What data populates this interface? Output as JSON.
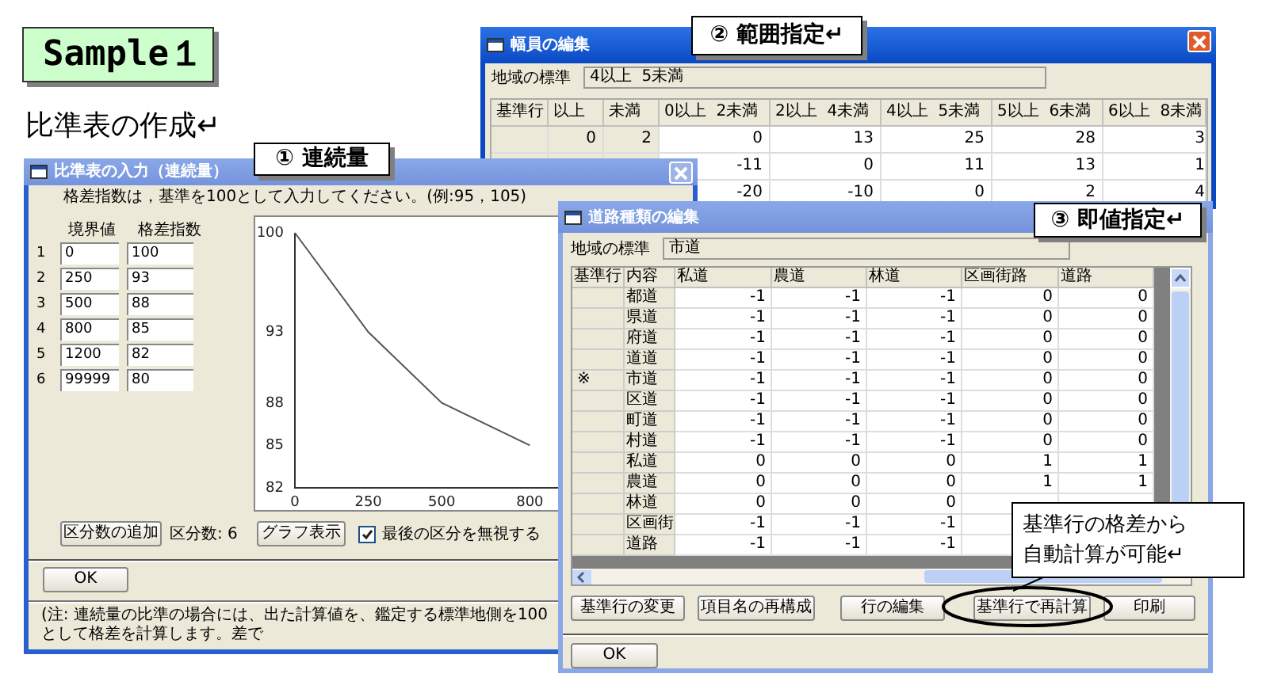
{
  "heading_box": {
    "text": "Sample１"
  },
  "heading": "比準表の作成↵",
  "callouts": [
    {
      "text": "① 連続量"
    },
    {
      "text": "② 範囲指定↵"
    },
    {
      "text": "③ 即値指定↵"
    }
  ],
  "width_window": {
    "title": "幅員の編集",
    "standard_label": "地域の標準",
    "standard_value": "4以上  5未満",
    "columns": [
      "基準行",
      "以上",
      "未満",
      "0以上  2未満",
      "2以上  4未満",
      "4以上  5未満",
      "5以上  6未満",
      "6以上  8未満"
    ],
    "rows": [
      {
        "lower": "0",
        "upper": "2",
        "values": [
          "0",
          "13",
          "25",
          "28",
          "3"
        ]
      },
      {
        "values": [
          "-11",
          "0",
          "11",
          "13",
          "1"
        ]
      },
      {
        "values": [
          "-20",
          "-10",
          "0",
          "2",
          "4"
        ]
      }
    ]
  },
  "continuous_window": {
    "title": "比準表の入力（連続量）",
    "instruction": "格差指数は，基準を100として入力してください。(例:95，105)",
    "columns": [
      "境界値",
      "格差指数"
    ],
    "rows": [
      {
        "number": "1",
        "boundary": "0",
        "index": "100"
      },
      {
        "number": "2",
        "boundary": "250",
        "index": "93"
      },
      {
        "number": "3",
        "boundary": "500",
        "index": "88"
      },
      {
        "number": "4",
        "boundary": "800",
        "index": "85"
      },
      {
        "number": "5",
        "boundary": "1200",
        "index": "82"
      },
      {
        "number": "6",
        "boundary": "99999",
        "index": "80"
      }
    ],
    "chart_data": {
      "type": "line",
      "x": [
        0,
        250,
        500,
        800
      ],
      "series": [
        {
          "color": "#555555",
          "values": [
            100,
            93,
            88,
            85
          ]
        }
      ],
      "xlim": [
        0,
        950
      ],
      "ylim": [
        82,
        100
      ],
      "xticks": [
        0,
        250,
        500,
        800
      ],
      "yticks": [
        82,
        85,
        88,
        93,
        100
      ]
    },
    "add_button": "区分数の追加",
    "count": "区分数: 6",
    "graph_button": "グラフ表示",
    "ignore_last": {
      "label": "最後の区分を無視する",
      "checked": true
    },
    "ok": "OK",
    "note": "(注:  連続量の比準の場合には、出た計算値を、鑑定する標準地側を100として格差を計算します。差で"
  },
  "road_window": {
    "title": "道路種類の編集",
    "standard_label": "地域の標準",
    "standard_value": "市道",
    "columns": [
      "基準行",
      "内容",
      "私道",
      "農道",
      "林道",
      "区画街路",
      "道路"
    ],
    "rows": [
      {
        "name": "都道",
        "values": [
          "-1",
          "-1",
          "-1",
          "0",
          "0"
        ]
      },
      {
        "name": "県道",
        "values": [
          "-1",
          "-1",
          "-1",
          "0",
          "0"
        ]
      },
      {
        "name": "府道",
        "values": [
          "-1",
          "-1",
          "-1",
          "0",
          "0"
        ]
      },
      {
        "name": "道道",
        "values": [
          "-1",
          "-1",
          "-1",
          "0",
          "0"
        ]
      },
      {
        "mark": "※",
        "name": "市道",
        "values": [
          "-1",
          "-1",
          "-1",
          "0",
          "0"
        ]
      },
      {
        "name": "区道",
        "values": [
          "-1",
          "-1",
          "-1",
          "0",
          "0"
        ]
      },
      {
        "name": "町道",
        "values": [
          "-1",
          "-1",
          "-1",
          "0",
          "0"
        ]
      },
      {
        "name": "村道",
        "values": [
          "-1",
          "-1",
          "-1",
          "0",
          "0"
        ]
      },
      {
        "name": "私道",
        "values": [
          "0",
          "0",
          "0",
          "1",
          "1"
        ]
      },
      {
        "name": "農道",
        "values": [
          "0",
          "0",
          "0",
          "1",
          "1"
        ]
      },
      {
        "name": "林道",
        "values": [
          "0",
          "0",
          "0"
        ]
      },
      {
        "name": "区画街",
        "values": [
          "-1",
          "-1",
          "-1"
        ]
      },
      {
        "name": "道路",
        "values": [
          "-1",
          "-1",
          "-1"
        ]
      }
    ],
    "buttons": [
      {
        "label": "基準行の変更",
        "circled": false
      },
      {
        "label": "項目名の再構成",
        "circled": false
      },
      {
        "label": "行の編集",
        "circled": false
      },
      {
        "label": "基準行で再計算",
        "circled": true
      },
      {
        "label": "印刷",
        "circled": false
      }
    ],
    "ok": "OK"
  },
  "annotation": {
    "lines": [
      "基準行の格差から",
      "自動計算が可能↵"
    ]
  }
}
